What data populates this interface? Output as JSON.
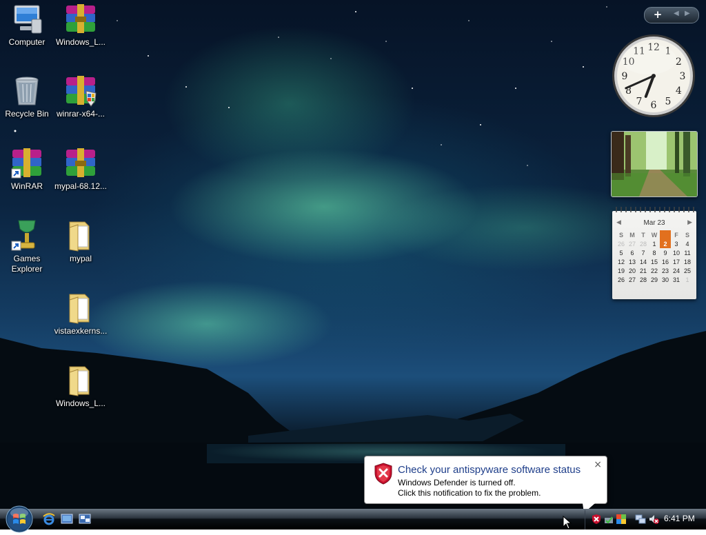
{
  "desktop": {
    "icons": [
      {
        "label": "Computer",
        "icon": "computer-icon"
      },
      {
        "label": "Windows_L...",
        "icon": "winrar-archive-icon"
      },
      {
        "label": "Recycle Bin",
        "icon": "recycle-bin-icon"
      },
      {
        "label": "winrar-x64-...",
        "icon": "winrar-installer-icon"
      },
      {
        "label": "WinRAR",
        "icon": "winrar-shortcut-icon"
      },
      {
        "label": "mypal-68.12...",
        "icon": "winrar-archive-icon"
      },
      {
        "label": "Games Explorer",
        "icon": "games-explorer-icon"
      },
      {
        "label": "mypal",
        "icon": "folder-icon"
      },
      {
        "label": "vistaexkerns...",
        "icon": "folder-icon"
      },
      {
        "label": "Windows_L...",
        "icon": "folder-icon"
      }
    ]
  },
  "gadgets": {
    "sidebar_controls": {
      "add": "+",
      "prev": "◀",
      "next": "▶"
    },
    "clock": {
      "numbers": [
        "12",
        "1",
        "2",
        "3",
        "4",
        "5",
        "6",
        "7",
        "8",
        "9",
        "10",
        "11"
      ],
      "hour": 6,
      "minute": 41
    },
    "slideshow": {
      "subject": "forest-path"
    },
    "calendar": {
      "month_label": "Mar 23",
      "weekdays": [
        "S",
        "M",
        "T",
        "W",
        "T",
        "F",
        "S"
      ],
      "today_index": 4,
      "weeks": [
        [
          [
            "26",
            1
          ],
          [
            "27",
            1
          ],
          [
            "28",
            1
          ],
          [
            "1",
            0
          ],
          [
            "2",
            2
          ],
          [
            "3",
            0
          ],
          [
            "4",
            0
          ]
        ],
        [
          [
            "5",
            0
          ],
          [
            "6",
            0
          ],
          [
            "7",
            0
          ],
          [
            "8",
            0
          ],
          [
            "9",
            0
          ],
          [
            "10",
            0
          ],
          [
            "11",
            0
          ]
        ],
        [
          [
            "12",
            0
          ],
          [
            "13",
            0
          ],
          [
            "14",
            0
          ],
          [
            "15",
            0
          ],
          [
            "16",
            0
          ],
          [
            "17",
            0
          ],
          [
            "18",
            0
          ]
        ],
        [
          [
            "19",
            0
          ],
          [
            "20",
            0
          ],
          [
            "21",
            0
          ],
          [
            "22",
            0
          ],
          [
            "23",
            0
          ],
          [
            "24",
            0
          ],
          [
            "25",
            0
          ]
        ],
        [
          [
            "26",
            0
          ],
          [
            "27",
            0
          ],
          [
            "28",
            0
          ],
          [
            "29",
            0
          ],
          [
            "30",
            0
          ],
          [
            "31",
            0
          ],
          [
            "1",
            1
          ]
        ]
      ]
    }
  },
  "notification": {
    "title": "Check your antispyware software status",
    "line1": "Windows Defender is turned off.",
    "line2": "Click this notification to fix the problem.",
    "close": "×"
  },
  "taskbar": {
    "quick_launch": [
      "internet-explorer-icon",
      "show-desktop-icon",
      "switch-windows-icon"
    ],
    "tray_icons": [
      "defender-warning-icon",
      "safely-remove-icon",
      "security-center-icon",
      "network-icon",
      "volume-muted-icon"
    ],
    "time": "6:41 PM"
  },
  "colors": {
    "accent": "#1e3e8a",
    "today": "#e2701e",
    "warning": "#c8102e"
  }
}
